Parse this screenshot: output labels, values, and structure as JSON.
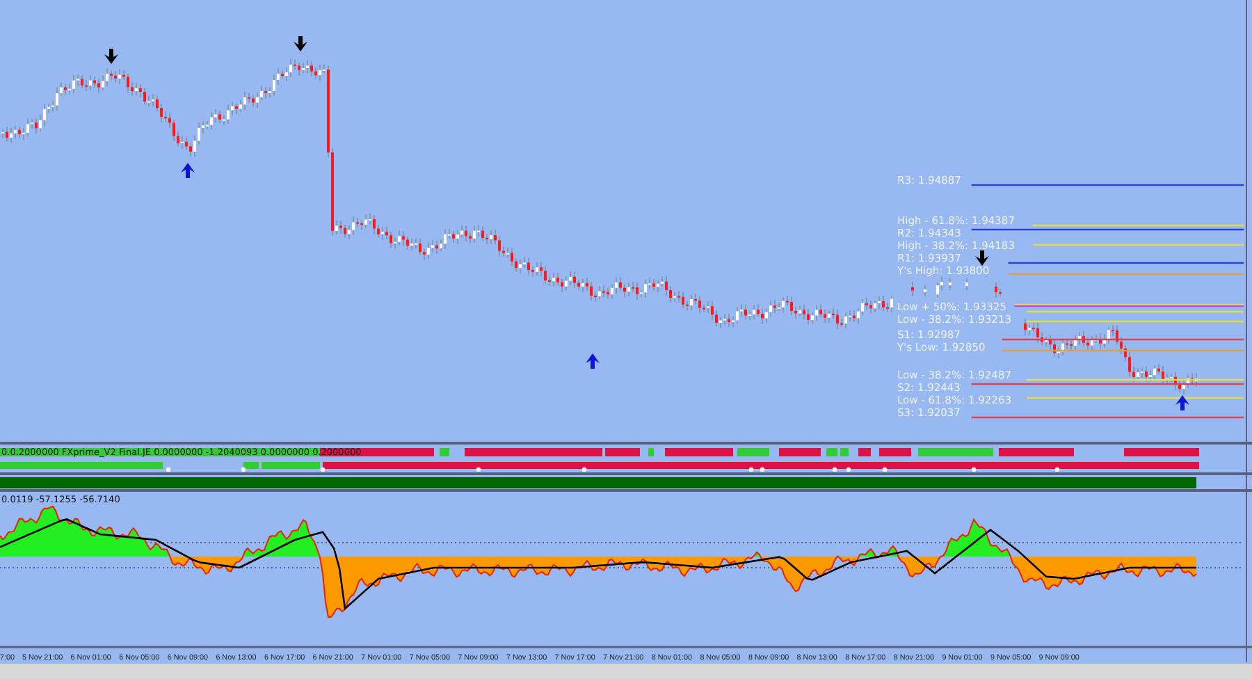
{
  "main_chart": {
    "pivot_levels": [
      {
        "label": "R3: 1.94887",
        "color": "#2b3fd6"
      },
      {
        "label": "High - 61.8%: 1.94387",
        "color": "#e0e040"
      },
      {
        "label": "R2: 1.94343",
        "color": "#2b3fd6"
      },
      {
        "label": "High - 38.2%: 1.94183",
        "color": "#e0e040"
      },
      {
        "label": "R1: 1.93937",
        "color": "#2b3fd6"
      },
      {
        "label": "Y's High: 1.93800",
        "color": "#e0a040"
      },
      {
        "color": "#e0e040"
      },
      {
        "color": "#d040e0"
      },
      {
        "label": "Low + 50%: 1.93325",
        "color": "#e0e040"
      },
      {
        "label": "Low - 38.2%: 1.93213",
        "color": "#e0e040"
      },
      {
        "label": "S1: 1.92987",
        "color": "#e04050"
      },
      {
        "label": "Y's Low: 1.92850",
        "color": "#e0a040"
      },
      {
        "label": "Low - 38.2%: 1.92487",
        "color": "#e0e040"
      },
      {
        "label": "S2: 1.92443",
        "color": "#e04050"
      },
      {
        "label": "Low - 61.8%: 1.92263",
        "color": "#e0e040"
      },
      {
        "label": "S3: 1.92037",
        "color": "#e04050"
      }
    ]
  },
  "indicator_panel": {
    "legend": "0.0.2000000  FXprime_V2 Final.JE 0.0000000 -1.2040093 0.0000000 0.2000000"
  },
  "oscillator_panel": {
    "readout": "0.0119 -57.1255 -56.7140"
  },
  "time_axis": {
    "labels": [
      "7:00",
      "5 Nov 21:00",
      "6 Nov 01:00",
      "6 Nov 05:00",
      "6 Nov 09:00",
      "6 Nov 13:00",
      "6 Nov 17:00",
      "6 Nov 21:00",
      "7 Nov 01:00",
      "7 Nov 05:00",
      "7 Nov 09:00",
      "7 Nov 13:00",
      "7 Nov 17:00",
      "7 Nov 21:00",
      "8 Nov 01:00",
      "8 Nov 05:00",
      "8 Nov 09:00",
      "8 Nov 13:00",
      "8 Nov 17:00",
      "8 Nov 21:00",
      "9 Nov 01:00",
      "9 Nov 05:00",
      "9 Nov 09:00"
    ]
  }
}
